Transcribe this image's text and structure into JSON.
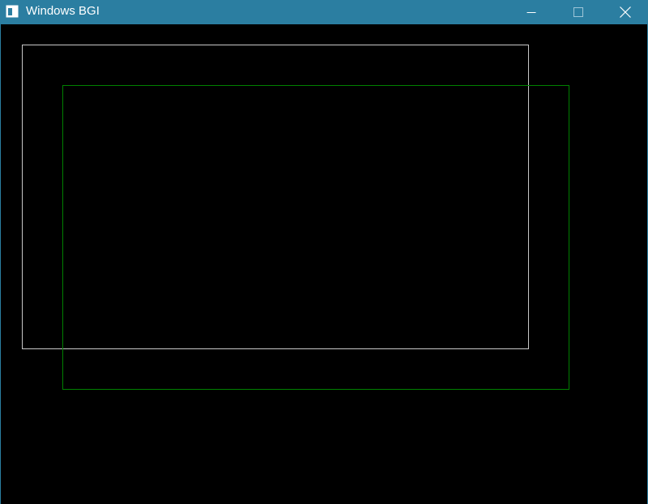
{
  "window": {
    "title": "Windows BGI",
    "titlebar_color": "#2b7ea1",
    "background_color": "#000000",
    "controls": {
      "minimize_icon": "minimize-icon",
      "maximize_icon": "maximize-icon",
      "close_icon": "close-icon"
    }
  },
  "canvas": {
    "shapes": [
      {
        "type": "rectangle",
        "color": "#c8c8c8"
      },
      {
        "type": "rectangle",
        "color": "#008000"
      }
    ]
  }
}
